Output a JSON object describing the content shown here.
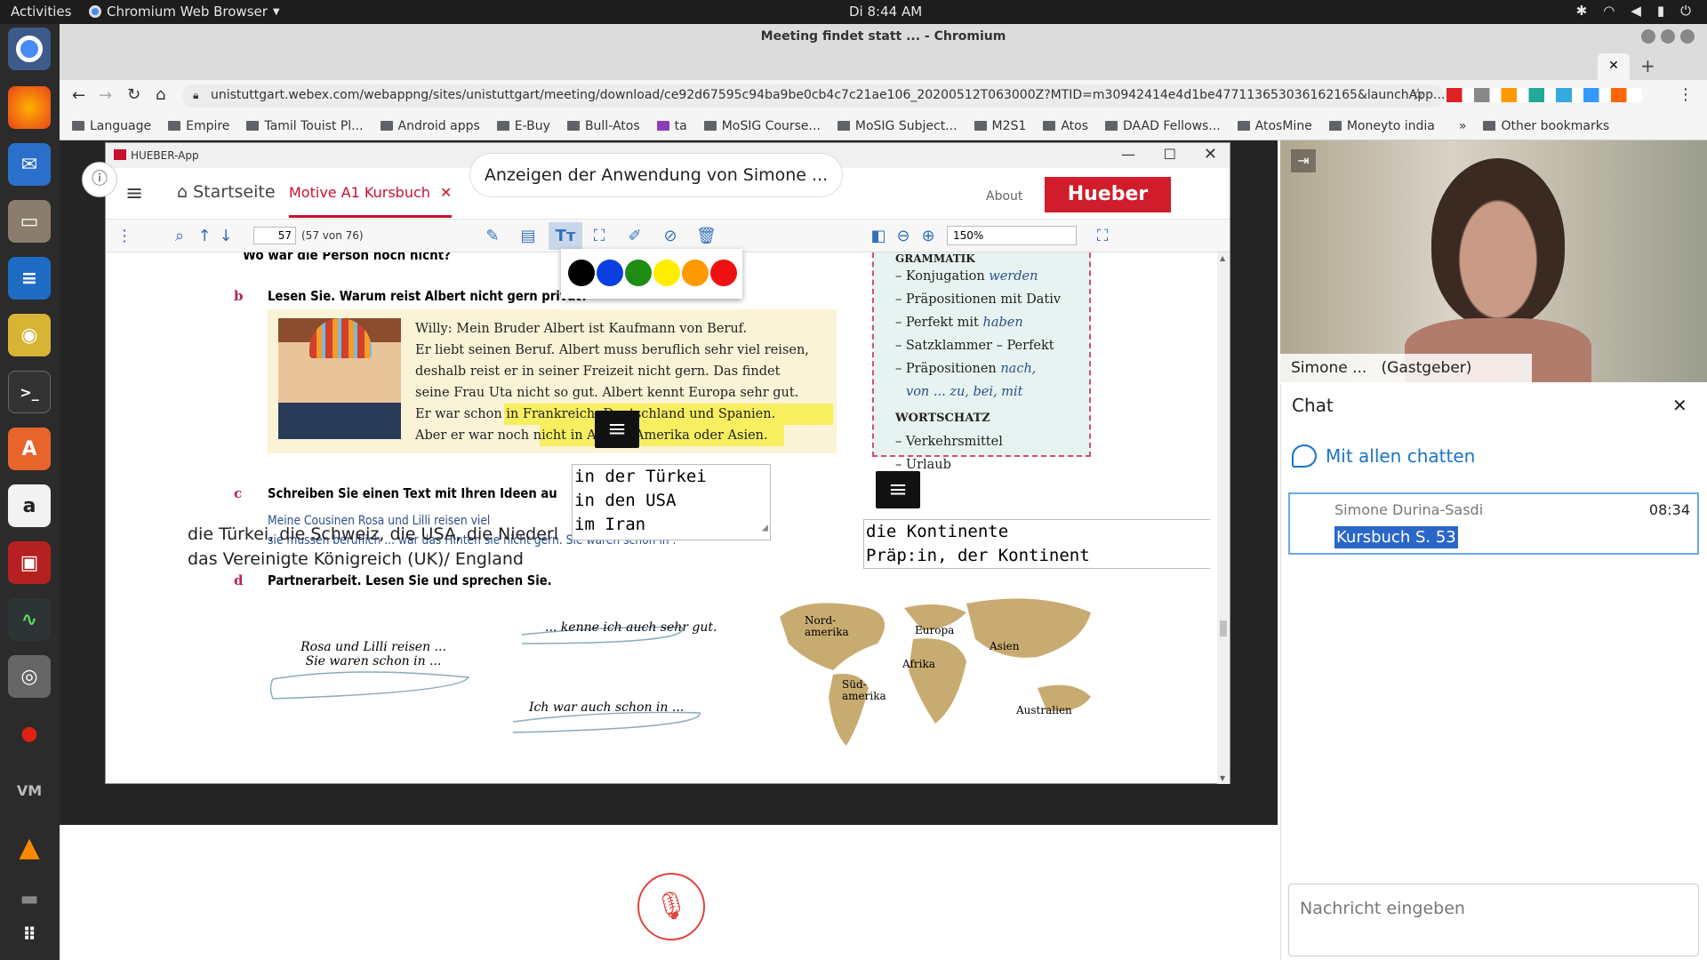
{
  "topbar": {
    "activities": "Activities",
    "app_name": "Chromium Web Browser",
    "clock": "Di  8:44 AM"
  },
  "browser": {
    "window_title": "Meeting findet statt ... - Chromium",
    "url": "unistuttgart.webex.com/webappng/sites/unistuttgart/meeting/download/ce92d67595c94ba9be0cb4c7c21ae106_20200512T063000Z?MTID=m30942414e4d1be477113653036162165&launchApp...",
    "bookmarks": [
      "Language",
      "Empire",
      "Tamil Touist Pl...",
      "Android apps",
      "E-Buy",
      "Bull-Atos",
      "ta",
      "MoSIG Course...",
      "MoSIG Subject...",
      "M2S1",
      "Atos",
      "DAAD Fellows...",
      "AtosMine",
      "Moneyto india"
    ],
    "other_bookmarks": "Other bookmarks",
    "overflow": "»"
  },
  "share": {
    "banner": "Anzeigen der Anwendung von Simone ..."
  },
  "hueber": {
    "window_title": "HUEBER-App",
    "home": "Startseite",
    "tab": "Motive A1 Kursbuch",
    "about": "About",
    "brand": "Hueber",
    "page_input": "57",
    "page_count": "(57 von 76)",
    "zoom": "150%"
  },
  "page": {
    "top_cut": "Wo war die Person noch nicht?",
    "b_letter": "b",
    "b_task": "Lesen Sie. Warum reist Albert nicht gern privat?",
    "story": [
      "Willy: Mein Bruder Albert ist Kaufmann von Beruf.",
      "Er liebt seinen Beruf. Albert muss beruflich sehr viel reisen,",
      "deshalb reist er in seiner Freizeit nicht gern. Das findet",
      "seine Frau Uta nicht so gut. Albert kennt Europa sehr gut.",
      "Er war schon in Frankreich, Deutschland und Spanien.",
      "Aber er war noch nicht in Afrika, Amerika oder Asien."
    ],
    "c_letter": "c",
    "c_task": "Schreiben Sie einen Text mit Ihren Ideen au",
    "c_sample1": "Meine Cousinen Rosa und Lilli reisen viel",
    "c_sample2": "sie mussen beruflich ... war das Hinten sie nicht gern. Sie waren schon in .",
    "overlay_line1": "die Türkei, die Schweiz, die USA, die Niederl",
    "overlay_line2": "das Vereinigte Königreich (UK)/ England",
    "d_letter": "d",
    "d_task": "Partnerarbeit. Lesen Sie und sprechen Sie.",
    "bubble1a": "Rosa und Lilli reisen ...",
    "bubble1b": "Sie waren schon in ...",
    "bubble2": "... kenne ich auch sehr gut.",
    "bubble3": "Ich war auch schon in ...",
    "note1": [
      "in der Türkei",
      "in den USA",
      "im Iran"
    ],
    "note2": [
      "die Kontinente",
      "Präp:in, der Kontinent"
    ],
    "grammar": {
      "heading": "GRAMMATIK",
      "items": [
        {
          "text": "– Konjugation ",
          "em": "werden"
        },
        {
          "text": "– Präpositionen mit Dativ",
          "em": ""
        },
        {
          "text": "– Perfekt mit ",
          "em": "haben"
        },
        {
          "text": "– Satzklammer – Perfekt",
          "em": ""
        },
        {
          "text": "– Präpositionen ",
          "em": "nach,"
        }
      ],
      "cont": "von ... zu, bei, mit",
      "vocab_heading": "WORTSCHATZ",
      "vocab": [
        "– Verkehrsmittel",
        "– Urlaub"
      ]
    },
    "map_labels": {
      "na1": "Nord-",
      "na2": "amerika",
      "eu": "Europa",
      "as": "Asien",
      "af": "Afrika",
      "sa1": "Süd-",
      "sa2": "amerika",
      "au": "Australien"
    }
  },
  "palette": [
    "#000000",
    "#0a3fe0",
    "#1f8c16",
    "#ffee00",
    "#ff9900",
    "#ee1111"
  ],
  "video": {
    "name": "Simone ...",
    "role": "(Gastgeber)"
  },
  "chat": {
    "title": "Chat",
    "channel": "Mit allen chatten",
    "sender": "Simone Durina-Sasdi",
    "time": "08:34",
    "message": "Kursbuch S. 53",
    "input_placeholder": "Nachricht eingeben"
  }
}
